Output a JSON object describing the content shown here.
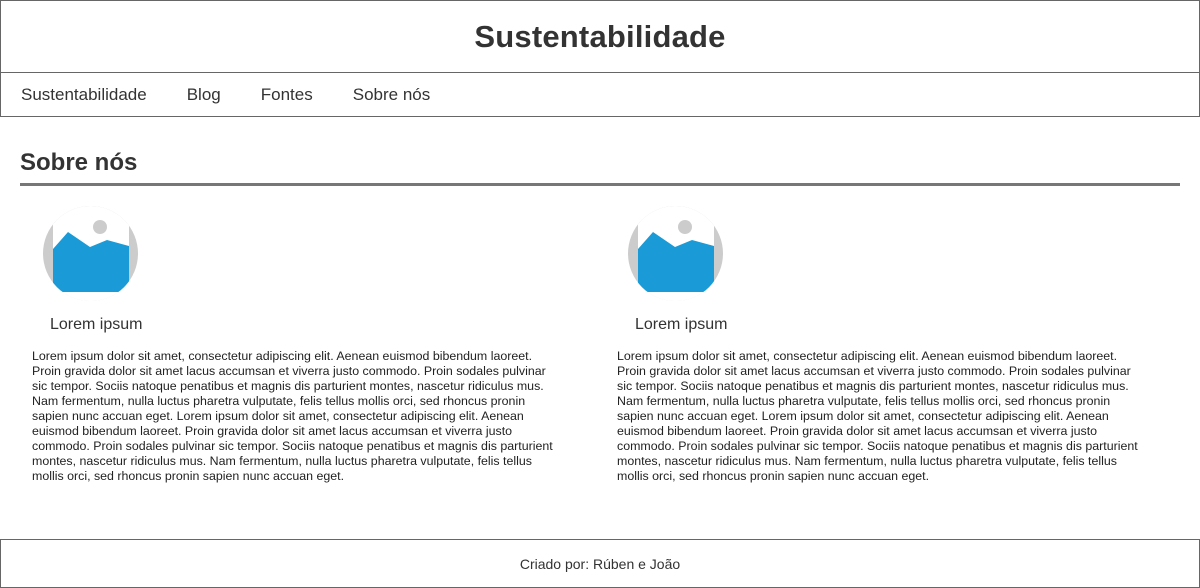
{
  "header": {
    "title": "Sustentabilidade"
  },
  "nav": {
    "items": [
      {
        "label": "Sustentabilidade"
      },
      {
        "label": "Blog"
      },
      {
        "label": "Fontes"
      },
      {
        "label": "Sobre nós"
      }
    ]
  },
  "main": {
    "section_title": "Sobre nós",
    "cards": [
      {
        "name": "Lorem ipsum",
        "text": "Lorem ipsum dolor sit amet, consectetur adipiscing elit. Aenean euismod bibendum laoreet. Proin gravida dolor sit amet lacus accumsan et viverra justo commodo. Proin sodales pulvinar sic tempor. Sociis natoque penatibus et magnis dis parturient montes, nascetur ridiculus mus. Nam fermentum, nulla luctus pharetra vulputate, felis tellus mollis orci, sed rhoncus pronin sapien nunc accuan eget. Lorem ipsum dolor sit amet, consectetur adipiscing elit. Aenean euismod bibendum laoreet. Proin gravida dolor sit amet lacus accumsan et viverra justo commodo. Proin sodales pulvinar sic tempor. Sociis natoque penatibus et magnis dis parturient montes, nascetur ridiculus mus. Nam fermentum, nulla luctus pharetra vulputate, felis tellus mollis orci, sed rhoncus pronin sapien nunc accuan eget.",
        "avatar_icon": "image-placeholder-icon"
      },
      {
        "name": "Lorem ipsum",
        "text": "Lorem ipsum dolor sit amet, consectetur adipiscing elit. Aenean euismod bibendum laoreet. Proin gravida dolor sit amet lacus accumsan et viverra justo commodo. Proin sodales pulvinar sic tempor. Sociis natoque penatibus et magnis dis parturient montes, nascetur ridiculus mus. Nam fermentum, nulla luctus pharetra vulputate, felis tellus mollis orci, sed rhoncus pronin sapien nunc accuan eget. Lorem ipsum dolor sit amet, consectetur adipiscing elit. Aenean euismod bibendum laoreet. Proin gravida dolor sit amet lacus accumsan et viverra justo commodo. Proin sodales pulvinar sic tempor. Sociis natoque penatibus et magnis dis parturient montes, nascetur ridiculus mus. Nam fermentum, nulla luctus pharetra vulputate, felis tellus mollis orci, sed rhoncus pronin sapien nunc accuan eget.",
        "avatar_icon": "image-placeholder-icon"
      }
    ]
  },
  "footer": {
    "credit": "Criado por: Rúben e João"
  },
  "colors": {
    "border": "#666666",
    "text": "#333333",
    "image_blue": "#1a9bd7",
    "image_gray": "#cccccc"
  }
}
